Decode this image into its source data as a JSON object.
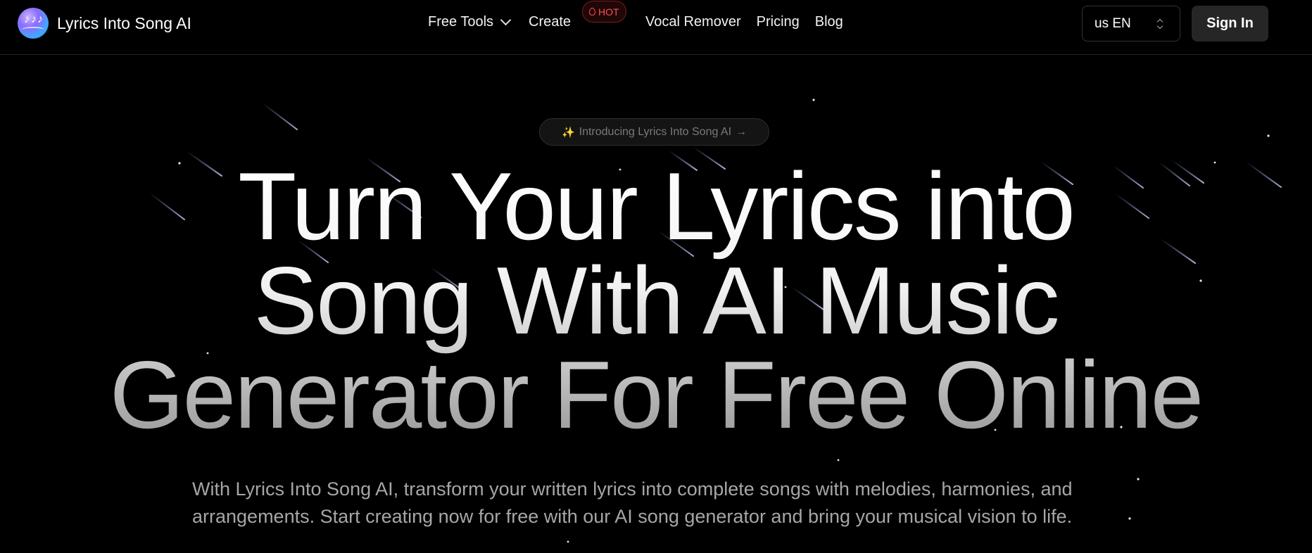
{
  "brand": {
    "name": "Lyrics Into Song AI",
    "logo_icon": "music-notes-logo"
  },
  "nav": {
    "free_tools": "Free Tools",
    "create": "Create",
    "hot_badge": "HOT",
    "vocal_remover": "Vocal Remover",
    "pricing": "Pricing",
    "blog": "Blog"
  },
  "language": {
    "selected": "us EN"
  },
  "auth": {
    "sign_in": "Sign In"
  },
  "hero": {
    "pill_sparkle": "✨",
    "pill_text": "Introducing Lyrics Into Song AI",
    "pill_arrow": "→",
    "headline_lines": [
      "Turn Your Lyrics into",
      "Song With AI Music",
      "Generator For Free Online"
    ],
    "subtitle": "With Lyrics Into Song AI, transform your written lyrics into complete songs with melodies, harmonies, and arrangements. Start creating now for free with our AI song generator and bring your musical vision to life."
  },
  "colors": {
    "background": "#000000",
    "hot": "#ff4d4d",
    "signin_bg": "#262626",
    "subtitle": "#a6a6a6"
  }
}
